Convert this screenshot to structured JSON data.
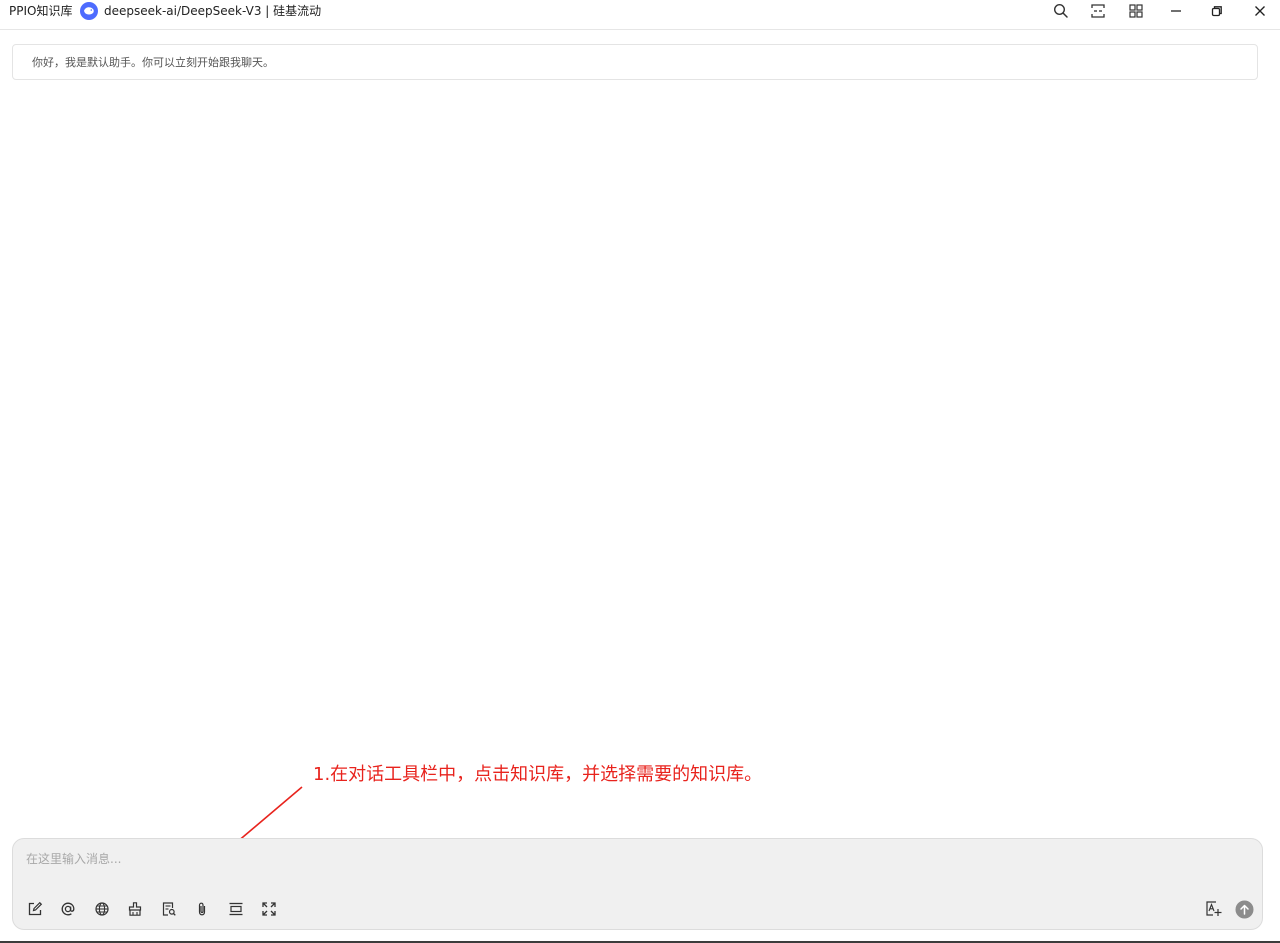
{
  "titlebar": {
    "app_title": "PPIO知识库",
    "model_name": "deepseek-ai/DeepSeek-V3 | 硅基流动",
    "model_icon": "deepseek-whale-icon",
    "buttons": [
      "search-icon",
      "narrow-mode-icon",
      "apps-grid-icon",
      "minimize-icon",
      "restore-icon",
      "close-icon"
    ]
  },
  "chat": {
    "greeting": "你好，我是默认助手。你可以立刻开始跟我聊天。"
  },
  "annotation": {
    "text": "1.在对话工具栏中，点击知识库，并选择需要的知识库。",
    "color": "#e8231d"
  },
  "composer": {
    "placeholder": "在这里输入消息...",
    "value": "",
    "tools": [
      "new-topic-icon",
      "mention-model-icon",
      "web-search-icon",
      "clear-context-icon",
      "knowledge-base-icon",
      "attachment-icon",
      "context-divider-icon",
      "expand-icon"
    ],
    "right_tools": [
      "translate-icon",
      "send-icon"
    ]
  },
  "colors": {
    "composer_bg": "#f0f0f0",
    "model_logo": "#4d6bfe"
  }
}
